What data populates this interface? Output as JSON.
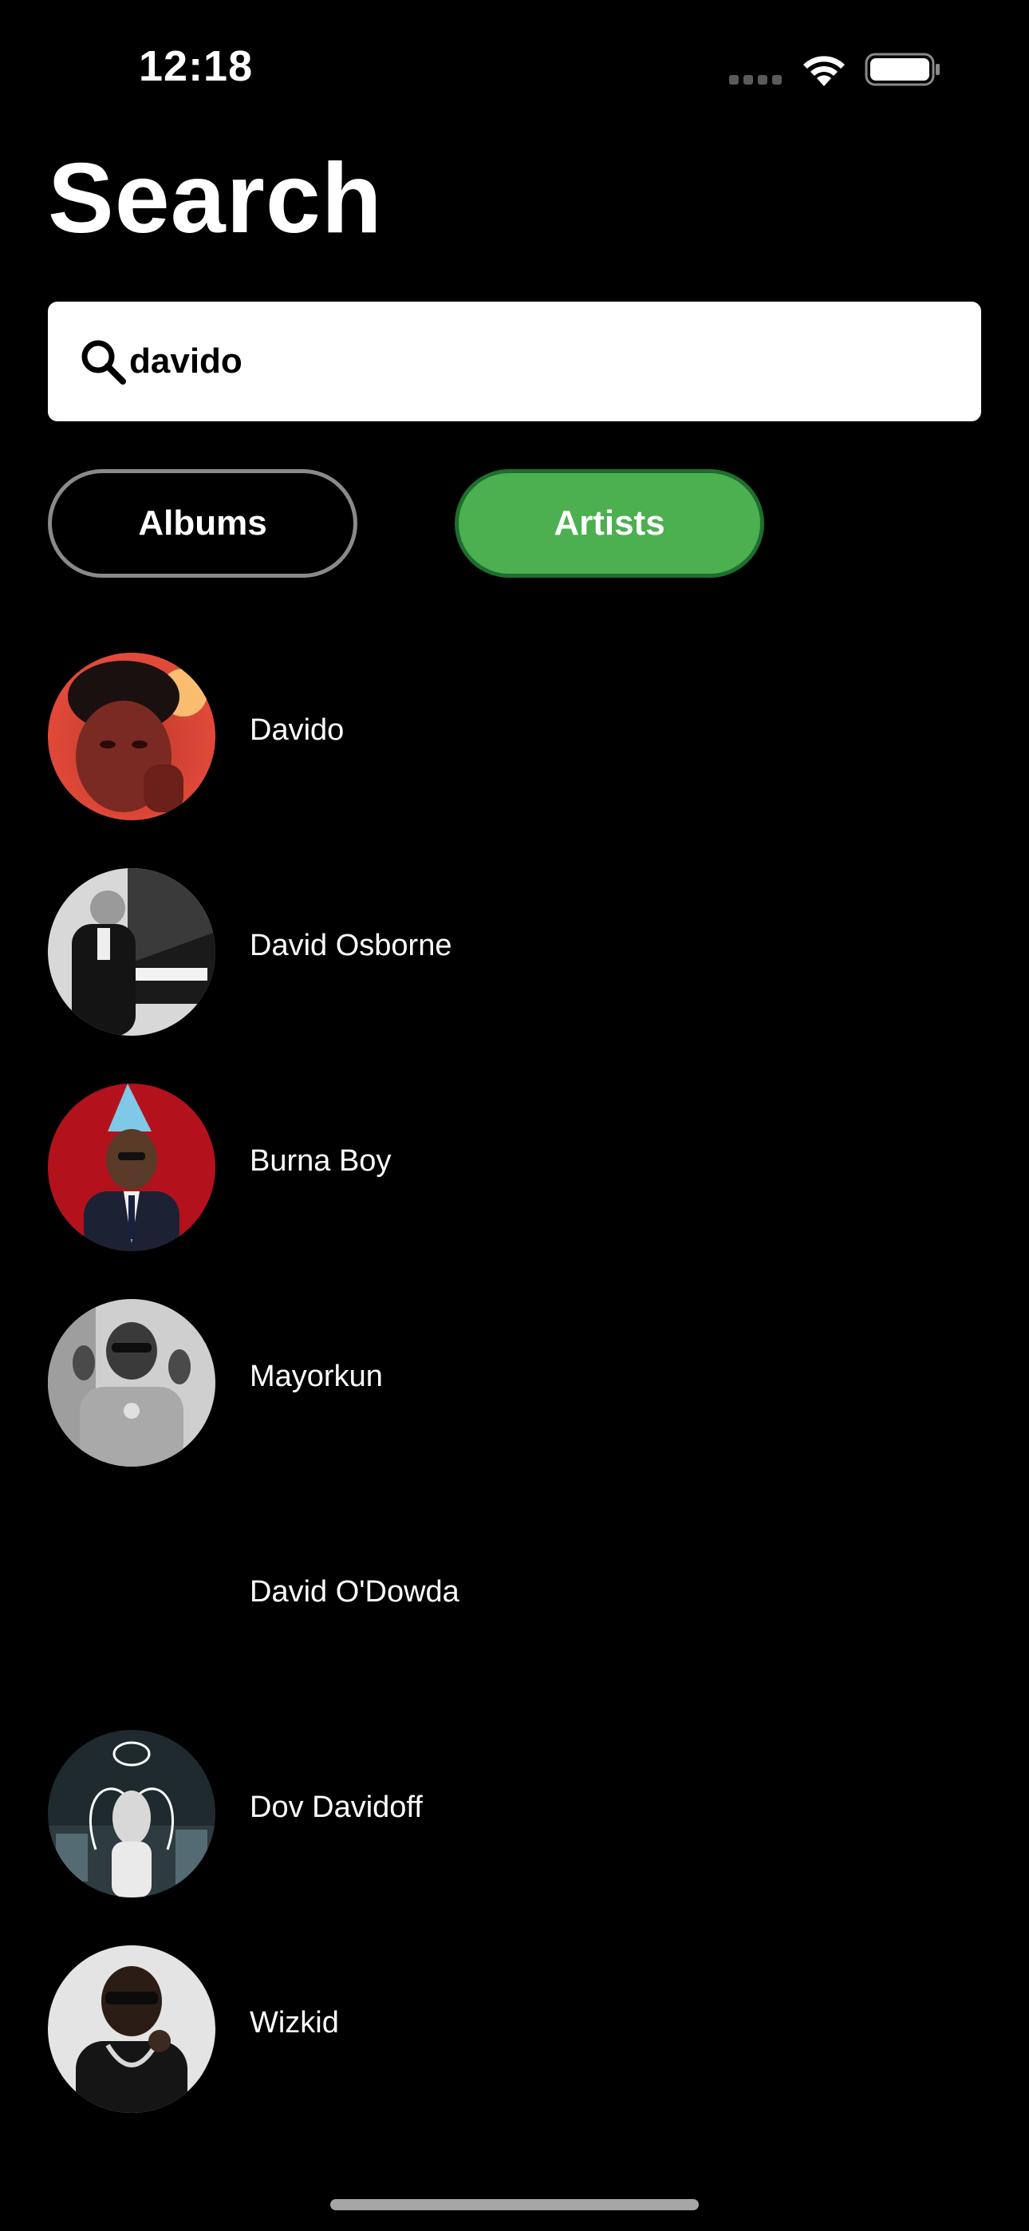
{
  "status_bar": {
    "time": "12:18"
  },
  "page": {
    "title": "Search"
  },
  "search": {
    "value": "davido",
    "placeholder": ""
  },
  "filters": {
    "albums_label": "Albums",
    "artists_label": "Artists",
    "selected": "Artists"
  },
  "colors": {
    "background": "#000000",
    "accent_green": "#4caf50",
    "accent_green_border": "#1e6e2e",
    "inactive_border": "#8a8a8a"
  },
  "artists": [
    {
      "name": "Davido",
      "image": "artist-photo"
    },
    {
      "name": "David Osborne",
      "image": "artist-photo"
    },
    {
      "name": "Burna Boy",
      "image": "artist-photo"
    },
    {
      "name": "Mayorkun",
      "image": "artist-photo"
    },
    {
      "name": "David O'Dowda",
      "image": "none"
    },
    {
      "name": "Dov Davidoff",
      "image": "artist-photo"
    },
    {
      "name": "Wizkid",
      "image": "artist-photo"
    }
  ]
}
